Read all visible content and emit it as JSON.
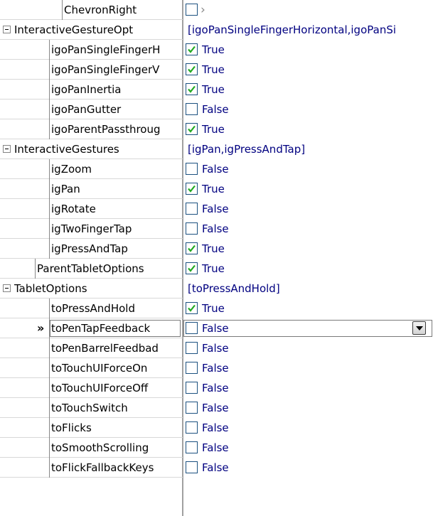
{
  "rows": [
    {
      "name": "ChevronRight",
      "value": "",
      "checkbox": "unchecked",
      "extra": "chevron"
    },
    {
      "name": "InteractiveGestureOpt",
      "value": "[igoPanSingleFingerHorizontal,igoPanSi",
      "group": true
    },
    {
      "name": "igoPanSingleFingerH",
      "value": "True",
      "checkbox": "checked"
    },
    {
      "name": "igoPanSingleFingerV",
      "value": "True",
      "checkbox": "checked"
    },
    {
      "name": "igoPanInertia",
      "value": "True",
      "checkbox": "checked"
    },
    {
      "name": "igoPanGutter",
      "value": "False",
      "checkbox": "unchecked"
    },
    {
      "name": "igoParentPassthroug",
      "value": "True",
      "checkbox": "checked"
    },
    {
      "name": "InteractiveGestures",
      "value": "[igPan,igPressAndTap]",
      "group": true
    },
    {
      "name": "igZoom",
      "value": "False",
      "checkbox": "unchecked"
    },
    {
      "name": "igPan",
      "value": "True",
      "checkbox": "checked"
    },
    {
      "name": "igRotate",
      "value": "False",
      "checkbox": "unchecked"
    },
    {
      "name": "igTwoFingerTap",
      "value": "False",
      "checkbox": "unchecked"
    },
    {
      "name": "igPressAndTap",
      "value": "True",
      "checkbox": "checked"
    },
    {
      "name": "ParentTabletOptions",
      "value": "True",
      "checkbox": "checked"
    },
    {
      "name": "TabletOptions",
      "value": "[toPressAndHold]",
      "group": true
    },
    {
      "name": "toPressAndHold",
      "value": "True",
      "checkbox": "checked"
    },
    {
      "name": "toPenTapFeedback",
      "value": "False",
      "checkbox": "unchecked",
      "selected": true
    },
    {
      "name": "toPenBarrelFeedbad",
      "value": "False",
      "checkbox": "unchecked"
    },
    {
      "name": "toTouchUIForceOn",
      "value": "False",
      "checkbox": "unchecked"
    },
    {
      "name": "toTouchUIForceOff",
      "value": "False",
      "checkbox": "unchecked"
    },
    {
      "name": "toTouchSwitch",
      "value": "False",
      "checkbox": "unchecked"
    },
    {
      "name": "toFlicks",
      "value": "False",
      "checkbox": "unchecked"
    },
    {
      "name": "toSmoothScrolling",
      "value": "False",
      "checkbox": "unchecked"
    },
    {
      "name": "toFlickFallbackKeys",
      "value": "False",
      "checkbox": "unchecked"
    }
  ],
  "selected_marker": "»",
  "colors": {
    "value_text": "#000080",
    "check": "#22aa22",
    "border": "#1c5180"
  }
}
